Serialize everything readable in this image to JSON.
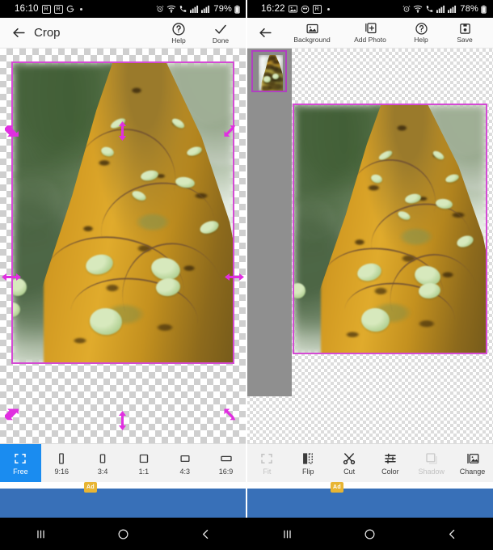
{
  "panels": [
    {
      "id": "crop-screen",
      "statusbar": {
        "clock": "16:10",
        "left_icons": [
          "r-badge-icon",
          "r-badge-icon",
          "google-g-icon",
          "dot-icon"
        ],
        "right_icons": [
          "alarm-icon",
          "wifi-icon",
          "call-icon",
          "signal-bar-icon",
          "signal-bar-icon"
        ],
        "battery": "79%"
      },
      "toolbar": {
        "back_icon": "arrow-left-icon",
        "title": "Crop",
        "actions": [
          {
            "label": "Help",
            "icon": "question-circle-icon"
          },
          {
            "label": "Done",
            "icon": "check-icon"
          }
        ]
      },
      "toolstrip": [
        {
          "label": "Free",
          "icon": "free-crop-icon",
          "state": "active"
        },
        {
          "label": "9:16",
          "icon": "ratio-9-16-icon",
          "state": "normal"
        },
        {
          "label": "3:4",
          "icon": "ratio-3-4-icon",
          "state": "normal"
        },
        {
          "label": "1:1",
          "icon": "ratio-1-1-icon",
          "state": "normal"
        },
        {
          "label": "4:3",
          "icon": "ratio-4-3-icon",
          "state": "normal"
        },
        {
          "label": "16:9",
          "icon": "ratio-16-9-icon",
          "state": "normal"
        }
      ],
      "ad": {
        "badge": "Ad"
      }
    },
    {
      "id": "editor-screen",
      "statusbar": {
        "clock": "16:22",
        "left_icons": [
          "gallery-icon",
          "app-icon",
          "r-badge-icon",
          "dot-icon"
        ],
        "right_icons": [
          "alarm-icon",
          "wifi-icon",
          "call-icon",
          "signal-bar-icon",
          "signal-bar-icon"
        ],
        "battery": "78%"
      },
      "toolbar": {
        "back_icon": "arrow-left-icon",
        "title": "",
        "actions": [
          {
            "label": "Background",
            "icon": "image-icon"
          },
          {
            "label": "Add Photo",
            "icon": "add-photo-icon"
          },
          {
            "label": "Help",
            "icon": "question-circle-icon"
          },
          {
            "label": "Save",
            "icon": "save-disk-icon"
          }
        ]
      },
      "toolstrip": [
        {
          "label": "Fit",
          "icon": "fit-icon",
          "state": "disabled"
        },
        {
          "label": "Flip",
          "icon": "flip-icon",
          "state": "normal"
        },
        {
          "label": "Cut",
          "icon": "scissors-icon",
          "state": "normal"
        },
        {
          "label": "Color",
          "icon": "sliders-icon",
          "state": "normal"
        },
        {
          "label": "Shadow",
          "icon": "shadow-icon",
          "state": "disabled"
        },
        {
          "label": "Change",
          "icon": "change-image-icon",
          "state": "normal"
        }
      ],
      "ad": {
        "badge": "Ad"
      }
    }
  ],
  "navbar": {
    "buttons": [
      {
        "name": "recents-button",
        "icon": "recents-icon"
      },
      {
        "name": "home-button",
        "icon": "home-circle-icon"
      },
      {
        "name": "back-button",
        "icon": "chevron-left-icon"
      }
    ]
  },
  "colors": {
    "accent_blue": "#1a8cf0",
    "crop_magenta": "#d44ad4",
    "handle_magenta": "#e02fe0",
    "toolbar_bg": "#fafafa",
    "toolstrip_bg": "#f2f2f2",
    "ad_blue": "#3870b8",
    "ad_badge": "#e8b533",
    "nav_bg": "#000000"
  },
  "photo": {
    "description": "close-up of a mossy orange tree trunk with green succulent vine leaves"
  }
}
